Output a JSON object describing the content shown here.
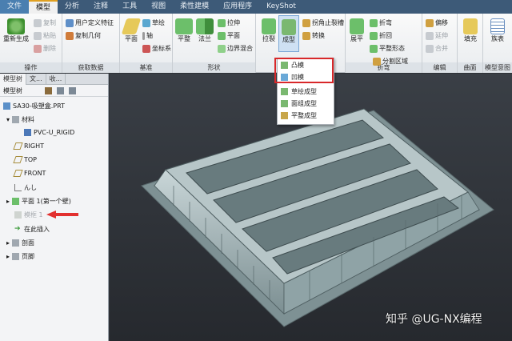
{
  "tabs": [
    "文件",
    "模型",
    "分析",
    "注释",
    "工具",
    "视图",
    "柔性建模",
    "应用程序",
    "KeyShot"
  ],
  "ribbon": {
    "operations": {
      "regenerate": "重新生成",
      "copy": "复制",
      "paste": "粘贴",
      "delete": "删除",
      "label": "操作"
    },
    "get_data": {
      "user_feature": "用户定义特征",
      "copy_geometry": "复制几何",
      "label": "获取数据"
    },
    "datum": {
      "plane": "平面",
      "sketch": "草绘",
      "axis": "轴",
      "csys": "坐标系",
      "label": "基准"
    },
    "shapes": {
      "planar": "平整",
      "flange": "法兰",
      "extrude": "拉伸",
      "flat": "平面",
      "boundary_blend": "边界混合",
      "label": "形状"
    },
    "engineering": {
      "extrude_cut": "拉裂",
      "form": "成型",
      "corner_relief": "拐角止裂槽",
      "convert": "转换"
    },
    "bends": {
      "unbend": "展平",
      "bend": "折弯",
      "bend_back": "折回",
      "flat_state": "平整形态",
      "label": "折弯"
    },
    "editing": {
      "offset": "偏移",
      "mirror": "延伸",
      "merge": "合并",
      "split_area": "分割区域",
      "label": "编辑"
    },
    "surfaces": {
      "fill": "填充",
      "label": "曲面"
    },
    "model_intent": {
      "table": "族表",
      "label": "模型意图"
    }
  },
  "form_menu": {
    "items": [
      "凸模",
      "凹模",
      "草绘成型",
      "面组成型",
      "平整成型"
    ]
  },
  "sidebar": {
    "tabs": [
      "模型树",
      "文...",
      "收..."
    ],
    "tree_label": "模型树",
    "items": [
      "SA30-吸塑盒.PRT",
      "材料",
      "PVC-U_RIGID",
      "RIGHT",
      "TOP",
      "FRONT",
      "んし",
      "平面 1(第一个壁)",
      "模框 1",
      "在此插入",
      "剖面",
      "页脚"
    ]
  },
  "watermark": "知乎 @UG-NX编程",
  "colors": {
    "accent": "#e0a020",
    "tabbar": "#3d5a78",
    "highlight": "#d8282a",
    "model": "#8fa3a6"
  }
}
